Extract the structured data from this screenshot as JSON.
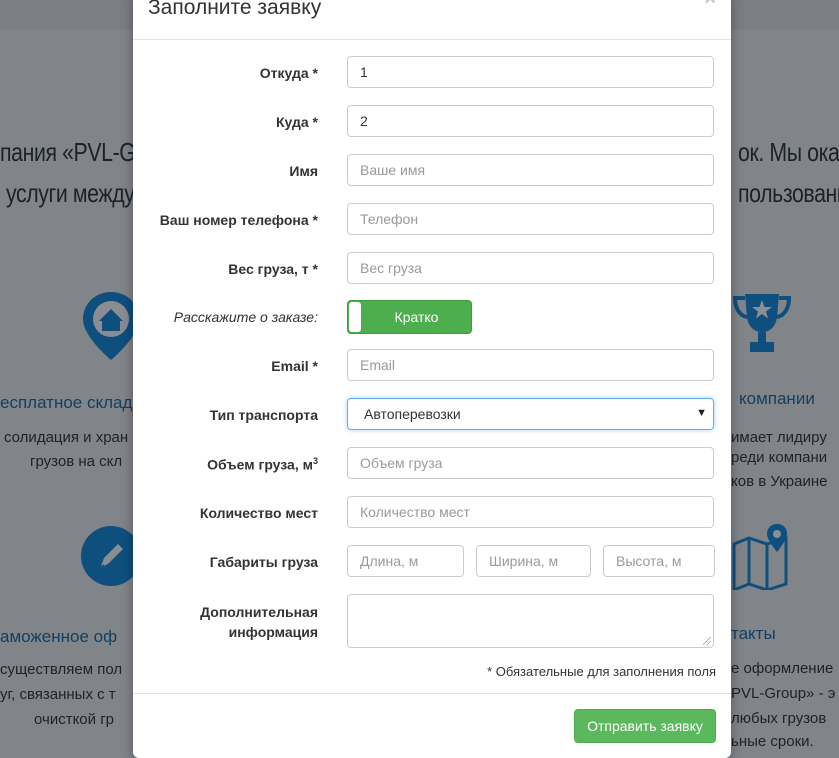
{
  "background": {
    "line1_left": "пания «PVL-Gro",
    "line1_right": "ок. Мы ока",
    "line2_left": "услуги междун",
    "line2_right": "пользование",
    "f1_title": "есплатное склад",
    "f1_desc1": "солидация и хран",
    "f1_desc2": "грузов на скл",
    "f2_title": "компании",
    "f2_desc1": "имает лидиру",
    "f2_desc2": "реди компани",
    "f2_desc3": "ков в Украине",
    "f3_title": "аможенное оф",
    "f3_desc1": "существляем пол",
    "f3_desc2": "уг, связанных с т",
    "f3_desc3": "очисткой гр",
    "f4_title": "такты",
    "f4_desc1": "е оформление",
    "f4_desc2": "PVL-Group» - э",
    "f4_desc3": "любых грузов",
    "f4_desc4": "ьные сроки."
  },
  "modal": {
    "title": "Заполните заявку",
    "close": "×",
    "fields": {
      "from": {
        "label": "Откуда *",
        "value": "1"
      },
      "to": {
        "label": "Куда *",
        "value": "2"
      },
      "name": {
        "label": "Имя",
        "placeholder": "Ваше имя"
      },
      "phone": {
        "label": "Ваш номер телефона *",
        "placeholder": "Телефон"
      },
      "weight": {
        "label": "Вес груза, т *",
        "placeholder": "Вес груза"
      },
      "order": {
        "label": "Расскажите о заказе:",
        "toggle": "Кратко"
      },
      "email": {
        "label": "Email *",
        "placeholder": "Email"
      },
      "transport": {
        "label": "Тип транспорта",
        "value": "Автоперевозки"
      },
      "volume": {
        "label": "Объем груза, м",
        "sup": "3",
        "placeholder": "Объем груза"
      },
      "places": {
        "label": "Количество мест",
        "placeholder": "Количество мест"
      },
      "dims": {
        "label": "Габариты груза",
        "length": "Длина, м",
        "width": "Ширина, м",
        "height": "Высота, м"
      },
      "extra": {
        "label1": "Дополнительная",
        "label2": "информация"
      }
    },
    "required_note": "* Обязательные для заполнения поля",
    "submit": "Отправить заявку"
  },
  "colors": {
    "accent_green": "#5cb85c",
    "icon_blue": "#0f4f7e",
    "focus_blue": "#66afe9"
  }
}
